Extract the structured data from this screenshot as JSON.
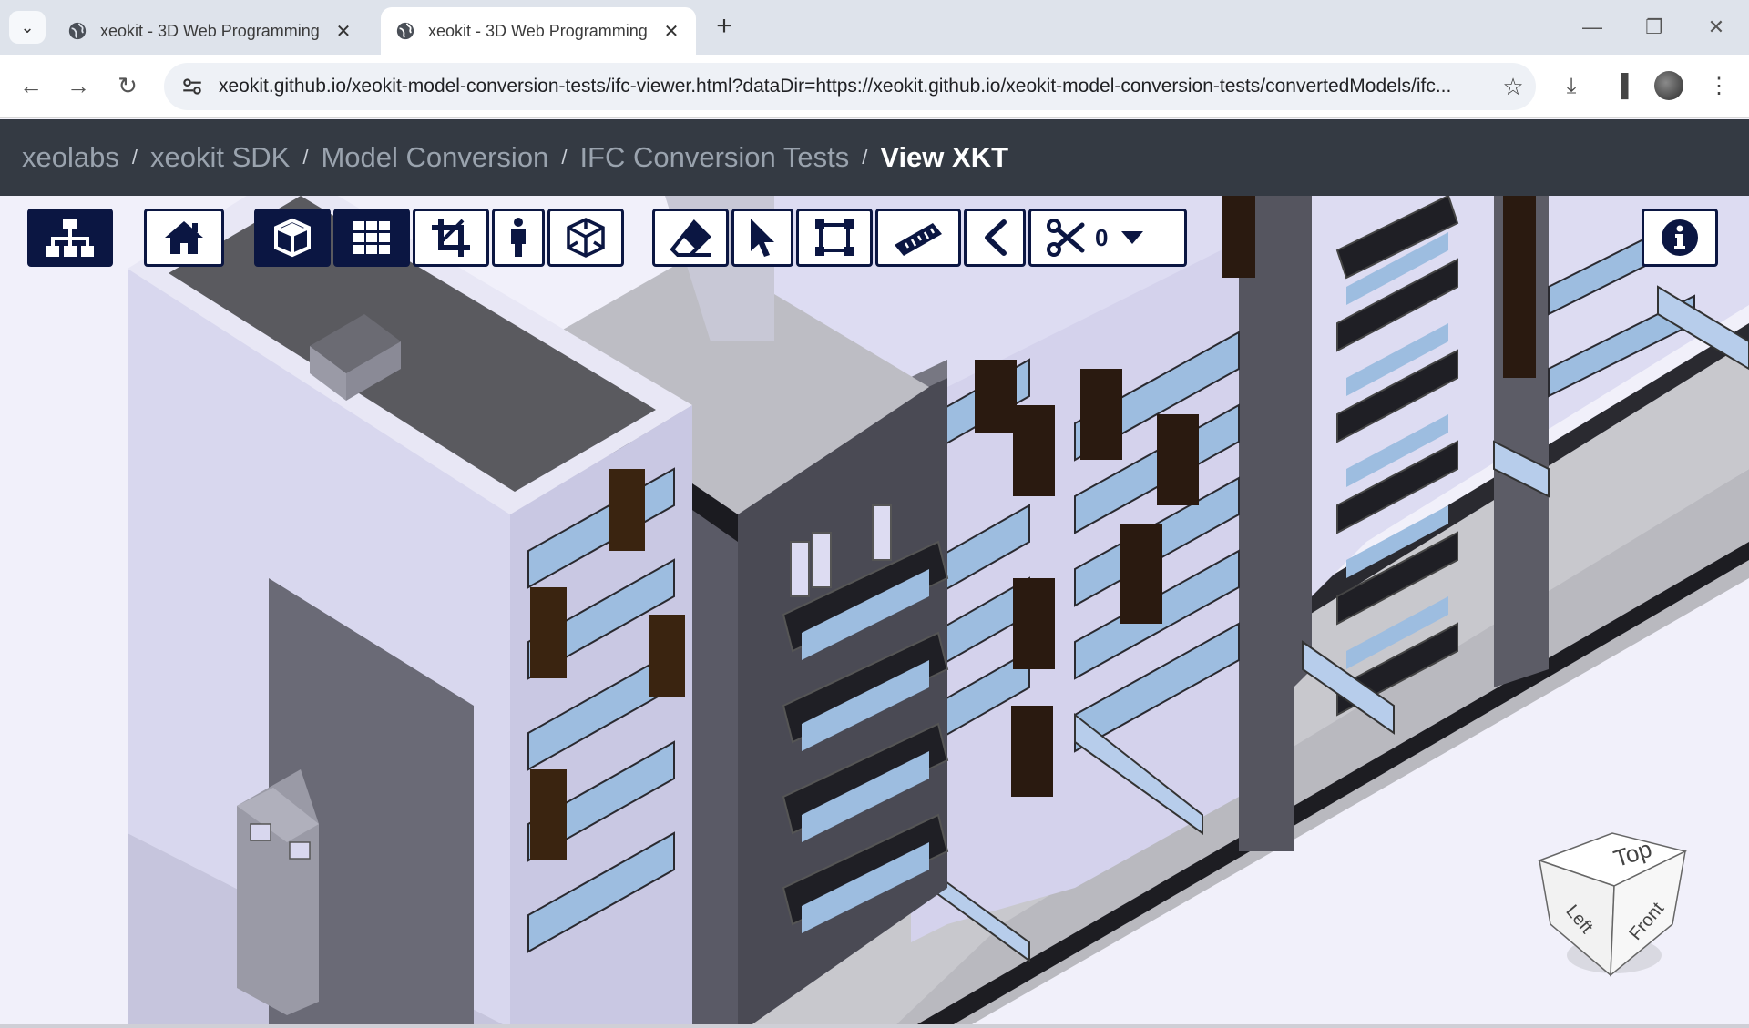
{
  "browser": {
    "tabs": [
      {
        "title": "xeokit - 3D Web Programming",
        "active": false
      },
      {
        "title": "xeokit - 3D Web Programming",
        "active": true
      }
    ],
    "url": "xeokit.github.io/xeokit-model-conversion-tests/ifc-viewer.html?dataDir=https://xeokit.github.io/xeokit-model-conversion-tests/convertedModels/ifc..."
  },
  "breadcrumb": {
    "items": [
      "xeolabs",
      "xeokit SDK",
      "Model Conversion",
      "IFC Conversion Tests"
    ],
    "current": "View XKT",
    "separator": "/"
  },
  "toolbar": {
    "section_count": "0",
    "buttons": [
      {
        "icon": "sitemap-icon",
        "active": true
      },
      {
        "icon": "home-icon",
        "active": false
      },
      {
        "icon": "cube-icon",
        "active": true
      },
      {
        "icon": "grid-icon",
        "active": true
      },
      {
        "icon": "crop-icon",
        "active": false
      },
      {
        "icon": "person-icon",
        "active": false
      },
      {
        "icon": "wireframe-cube-icon",
        "active": false
      },
      {
        "icon": "eraser-icon",
        "active": false
      },
      {
        "icon": "pointer-icon",
        "active": false
      },
      {
        "icon": "marquee-select-icon",
        "active": false
      },
      {
        "icon": "ruler-icon",
        "active": false
      },
      {
        "icon": "angle-icon",
        "active": false
      },
      {
        "icon": "scissors-icon",
        "active": false
      },
      {
        "icon": "info-icon",
        "active": false
      }
    ]
  },
  "navcube": {
    "top": "Top",
    "left": "Left",
    "front": "Front"
  },
  "colors": {
    "accent": "#0b1642",
    "navbar": "#343a43",
    "crumb": "#9aa3ae",
    "chrome": "#dee3eb"
  }
}
